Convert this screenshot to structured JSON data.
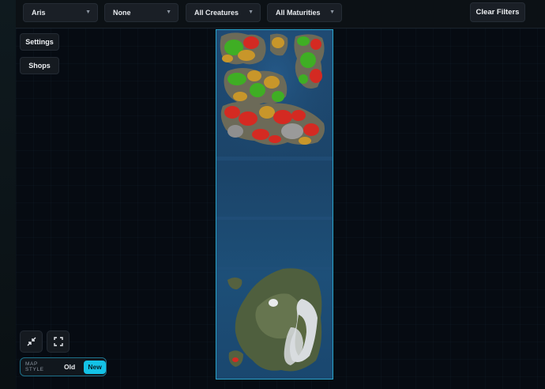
{
  "filters": {
    "map": {
      "value": "Aris"
    },
    "secondary": {
      "value": "None"
    },
    "creatures": {
      "value": "All Creatures"
    },
    "maturities": {
      "value": "All Maturities"
    },
    "clear_label": "Clear Filters"
  },
  "side_menu": {
    "settings_label": "Settings",
    "shops_label": "Shops"
  },
  "controls": {
    "collapse_icon": "collapse-arrows-icon",
    "fullscreen_icon": "fullscreen-icon"
  },
  "map_style": {
    "label": "MAP STYLE",
    "options": [
      "Old",
      "New"
    ],
    "selected": "New"
  },
  "colors": {
    "accent": "#14c2e6",
    "zone_red": "#d42a22",
    "zone_green": "#3fae24",
    "zone_orange": "#c8962a",
    "water": "#1f4d78"
  }
}
